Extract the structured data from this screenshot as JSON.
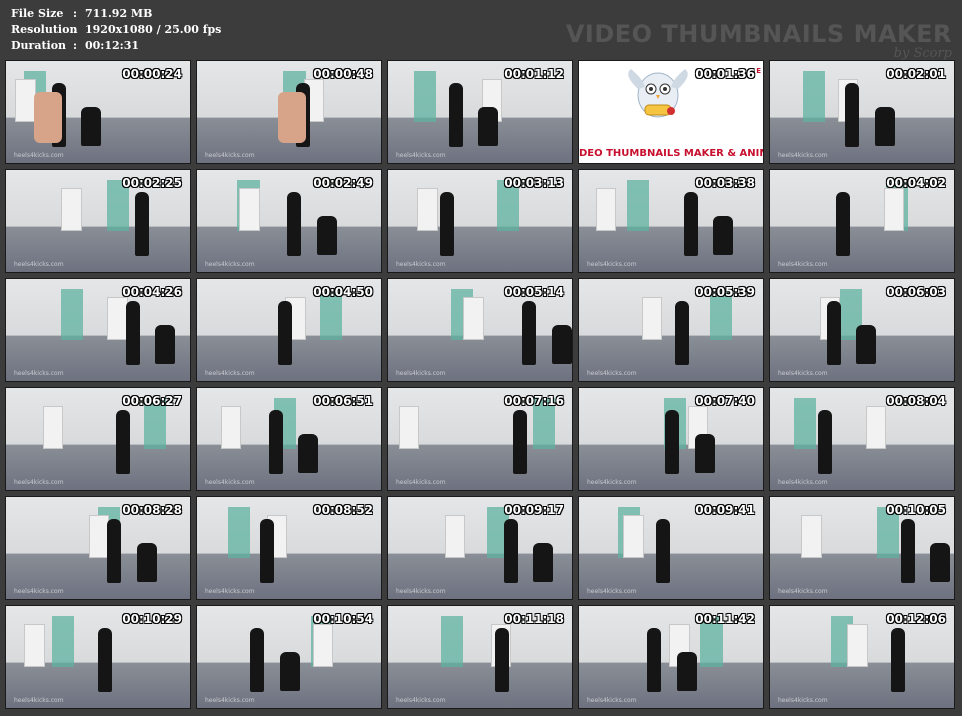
{
  "info": {
    "file_size_label": "File Size",
    "file_size_value": "711.92 MB",
    "resolution_label": "Resolution",
    "resolution_value": "1920x1080 / 25.00 fps",
    "duration_label": "Duration",
    "duration_value": "00:12:31",
    "separator": ":"
  },
  "brand": {
    "title": "VIDEO THUMBNAILS MAKER",
    "subtitle": "by Scorp"
  },
  "watermark": "heels4kicks.com",
  "logo": {
    "text": "DEO THUMBNAILS MAKER & ANIMAT",
    "mark": "E"
  },
  "thumbnails": [
    {
      "time": "00:00:24"
    },
    {
      "time": "00:00:48"
    },
    {
      "time": "00:01:12"
    },
    {
      "time": "00:01:36",
      "logo": true
    },
    {
      "time": "00:02:01"
    },
    {
      "time": "00:02:25"
    },
    {
      "time": "00:02:49"
    },
    {
      "time": "00:03:13"
    },
    {
      "time": "00:03:38"
    },
    {
      "time": "00:04:02"
    },
    {
      "time": "00:04:26"
    },
    {
      "time": "00:04:50"
    },
    {
      "time": "00:05:14"
    },
    {
      "time": "00:05:39"
    },
    {
      "time": "00:06:03"
    },
    {
      "time": "00:06:27"
    },
    {
      "time": "00:06:51"
    },
    {
      "time": "00:07:16"
    },
    {
      "time": "00:07:40"
    },
    {
      "time": "00:08:04"
    },
    {
      "time": "00:08:28"
    },
    {
      "time": "00:08:52"
    },
    {
      "time": "00:09:17"
    },
    {
      "time": "00:09:41"
    },
    {
      "time": "00:10:05"
    },
    {
      "time": "00:10:29"
    },
    {
      "time": "00:10:54"
    },
    {
      "time": "00:11:18"
    },
    {
      "time": "00:11:42"
    },
    {
      "time": "00:12:06"
    }
  ]
}
